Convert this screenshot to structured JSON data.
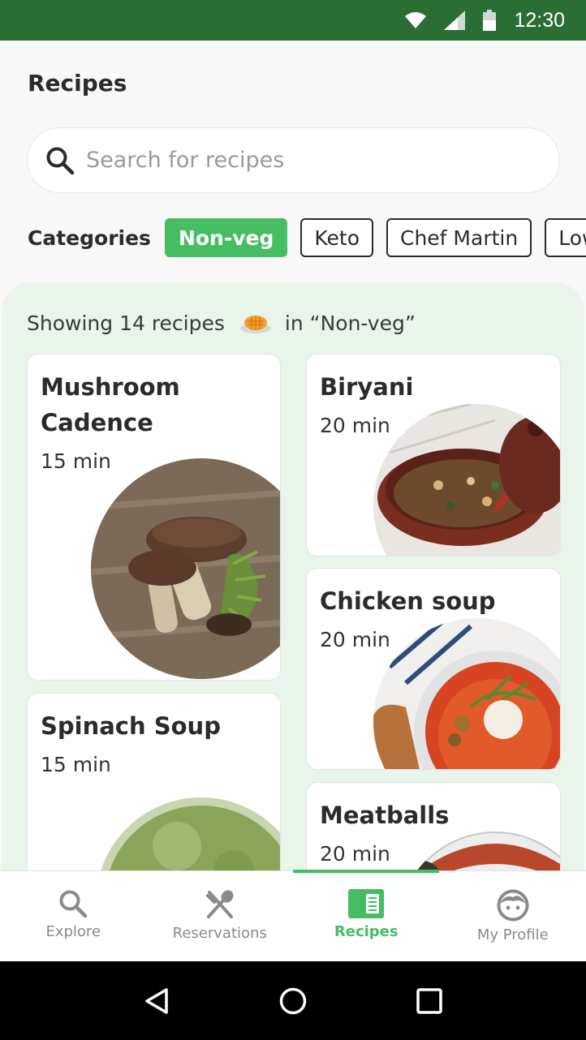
{
  "status_bar": {
    "time": "12:30",
    "icons": [
      "wifi-icon",
      "signal-icon",
      "battery-icon"
    ],
    "background": "#2a6e36"
  },
  "page": {
    "title": "Recipes"
  },
  "search": {
    "placeholder": "Search for recipes",
    "value": ""
  },
  "categories": {
    "label": "Categories",
    "chips": [
      {
        "label": "Non-veg",
        "active": true
      },
      {
        "label": "Keto",
        "active": false
      },
      {
        "label": "Chef Martin",
        "active": false
      },
      {
        "label": "Low carb",
        "active": false
      }
    ]
  },
  "results": {
    "prefix": "Showing 14 recipes",
    "suffix": "in “Non-veg”",
    "icon": "waffle-icon"
  },
  "recipes": [
    {
      "title_line1": "Mushroom",
      "title_line2": "Cadence",
      "time": "15 min",
      "image": "mushroom-photo"
    },
    {
      "title": "Biryani",
      "time": "20 min",
      "image": "biryani-photo"
    },
    {
      "title": "Chicken soup",
      "time": "20 min",
      "image": "chicken-soup-photo"
    },
    {
      "title": "Spinach Soup",
      "time": "15 min",
      "image": "spinach-soup-photo"
    },
    {
      "title": "Meatballs",
      "time": "20 min",
      "image": "meatballs-photo"
    }
  ],
  "bottom_nav": [
    {
      "label": "Explore",
      "icon": "search-icon",
      "active": false
    },
    {
      "label": "Reservations",
      "icon": "fork-spoon-icon",
      "active": false
    },
    {
      "label": "Recipes",
      "icon": "recipe-book-icon",
      "active": true
    },
    {
      "label": "My Profile",
      "icon": "profile-face-icon",
      "active": false
    }
  ],
  "colors": {
    "accent": "#46bd62",
    "panel": "#e9f5ea",
    "text": "#2b2b2b"
  }
}
